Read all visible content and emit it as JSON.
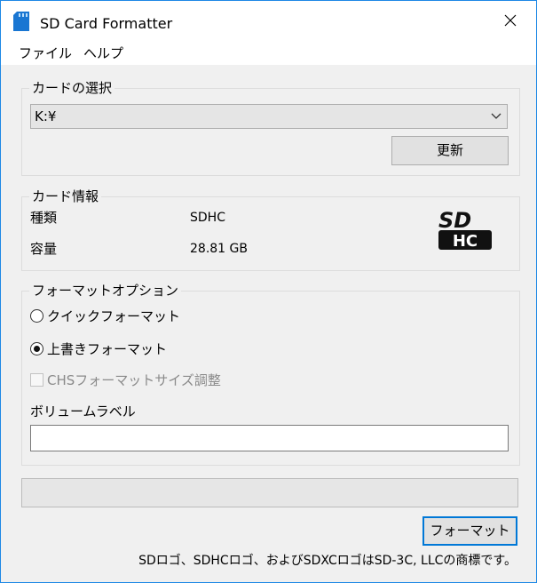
{
  "window": {
    "title": "SD Card Formatter"
  },
  "menu": {
    "file": "ファイル",
    "help": "ヘルプ"
  },
  "card_select": {
    "legend": "カードの選択",
    "drive": "K:¥",
    "refresh_label": "更新"
  },
  "card_info": {
    "legend": "カード情報",
    "type_label": "種類",
    "type_value": "SDHC",
    "capacity_label": "容量",
    "capacity_value": "28.81 GB",
    "logo": {
      "top": "SD",
      "bottom": "HC"
    }
  },
  "format_options": {
    "legend": "フォーマットオプション",
    "quick_label": "クイックフォーマット",
    "quick_checked": false,
    "overwrite_label": "上書きフォーマット",
    "overwrite_checked": true,
    "chs_label": "CHSフォーマットサイズ調整",
    "chs_enabled": false,
    "volume_label_title": "ボリュームラベル",
    "volume_label_value": ""
  },
  "progress": {
    "percent": 0
  },
  "actions": {
    "format_label": "フォーマット"
  },
  "footer": {
    "note": "SDロゴ、SDHCロゴ、およびSDXCロゴはSD-3C, LLCの商標です。"
  }
}
